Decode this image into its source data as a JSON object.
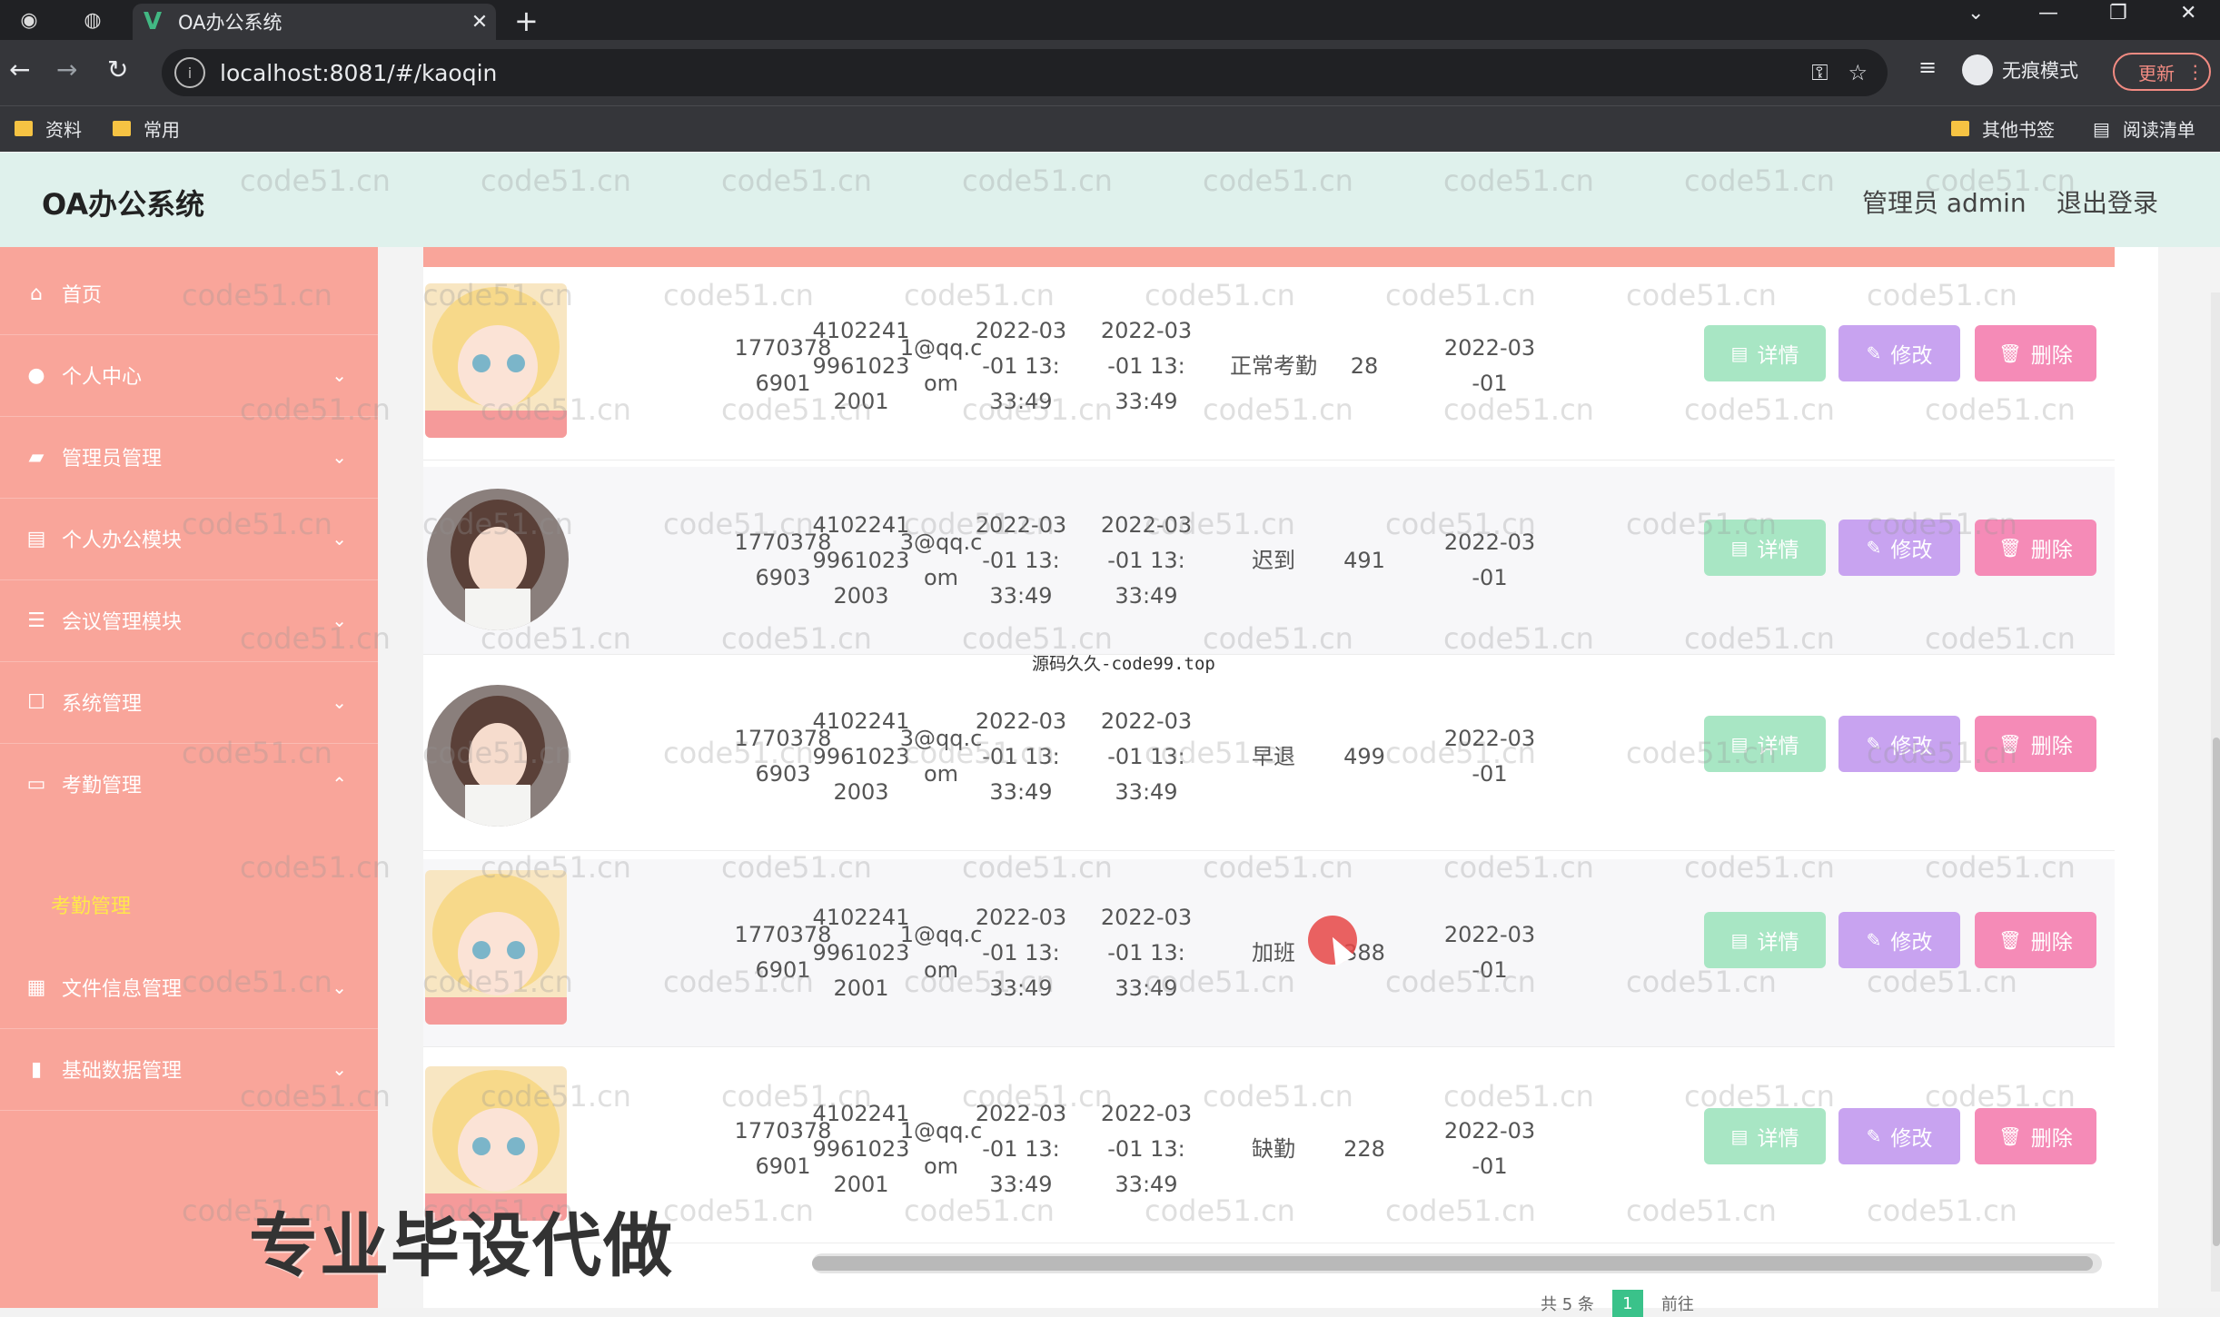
{
  "browser": {
    "tab_title": "OA办公系统",
    "url": "localhost:8081/#/kaoqin",
    "incognito_label": "无痕模式",
    "update_label": "更新",
    "bookmarks": [
      "资料",
      "常用"
    ],
    "bookmarks_right": [
      "其他书签",
      "阅读清单"
    ]
  },
  "app": {
    "title": "OA办公系统",
    "admin_label": "管理员 admin",
    "logout_label": "退出登录"
  },
  "sidebar": {
    "items": [
      {
        "label": "首页",
        "icon": "home-icon"
      },
      {
        "label": "个人中心",
        "icon": "user-icon"
      },
      {
        "label": "管理员管理",
        "icon": "admin-icon"
      },
      {
        "label": "个人办公模块",
        "icon": "briefcase-icon"
      },
      {
        "label": "会议管理模块",
        "icon": "sliders-icon"
      },
      {
        "label": "系统管理",
        "icon": "square-icon"
      },
      {
        "label": "考勤管理",
        "icon": "card-icon"
      },
      {
        "label": "文件信息管理",
        "icon": "file-icon"
      },
      {
        "label": "基础数据管理",
        "icon": "chart-icon"
      }
    ],
    "active_sub": "考勤管理"
  },
  "table": {
    "rows": [
      {
        "phone": "17703786901",
        "idcard": "410224199610232001",
        "email": "1@qq.com",
        "time1": "2022-03-01 13:33:49",
        "time2": "2022-03-01 13:33:49",
        "status": "正常考勤",
        "count": "28",
        "date": "2022-03-01",
        "avatar": "blonde"
      },
      {
        "phone": "17703786903",
        "idcard": "410224199610232003",
        "email": "3@qq.com",
        "time1": "2022-03-01 13:33:49",
        "time2": "2022-03-01 13:33:49",
        "status": "迟到",
        "count": "491",
        "date": "2022-03-01",
        "avatar": "brunette"
      },
      {
        "phone": "17703786903",
        "idcard": "410224199610232003",
        "email": "3@qq.com",
        "time1": "2022-03-01 13:33:49",
        "time2": "2022-03-01 13:33:49",
        "status": "早退",
        "count": "499",
        "date": "2022-03-01",
        "avatar": "brunette"
      },
      {
        "phone": "17703786901",
        "idcard": "410224199610232001",
        "email": "1@qq.com",
        "time1": "2022-03-01 13:33:49",
        "time2": "2022-03-01 13:33:49",
        "status": "加班",
        "count": "388",
        "date": "2022-03-01",
        "avatar": "blonde"
      },
      {
        "phone": "17703786901",
        "idcard": "410224199610232001",
        "email": "1@qq.com",
        "time1": "2022-03-01 13:33:49",
        "time2": "2022-03-01 13:33:49",
        "status": "缺勤",
        "count": "228",
        "date": "2022-03-01",
        "avatar": "blonde"
      }
    ],
    "buttons": {
      "detail": "详情",
      "edit": "修改",
      "delete": "删除"
    }
  },
  "pager": {
    "total": "共 5 条",
    "current": "1",
    "goto": "前往"
  },
  "watermark": "code51.cn",
  "center_watermark": "源码久久-code99.top",
  "overlay_text": "专业毕设代做"
}
